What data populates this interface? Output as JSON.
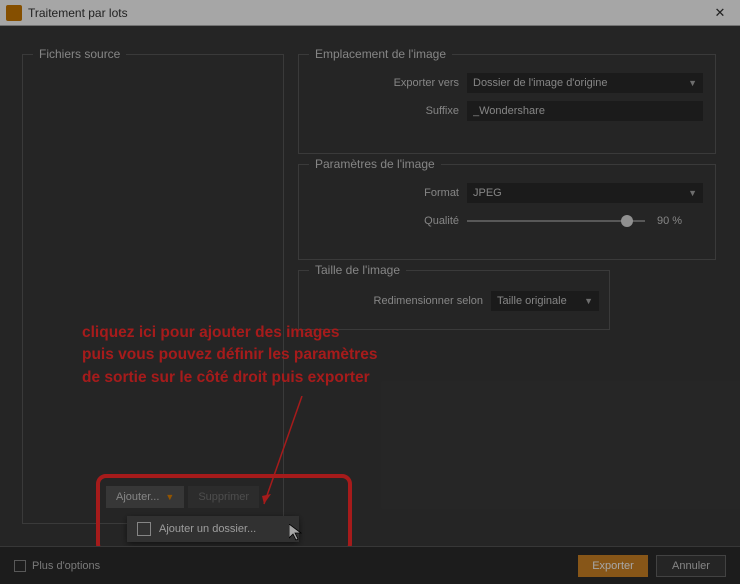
{
  "titlebar": {
    "title": "Traitement par lots"
  },
  "source": {
    "legend": "Fichiers source",
    "add_label": "Ajouter...",
    "del_label": "Supprimer",
    "menu_item": "Ajouter un dossier..."
  },
  "loc": {
    "legend": "Emplacement de l'image",
    "export_label": "Exporter vers",
    "export_value": "Dossier de l'image d'origine",
    "suffix_label": "Suffixe",
    "suffix_value": "_Wondershare"
  },
  "param": {
    "legend": "Paramètres de l'image",
    "format_label": "Format",
    "format_value": "JPEG",
    "quality_label": "Qualité",
    "quality_value": "90 %"
  },
  "size": {
    "legend": "Taille de l'image",
    "resize_label": "Redimensionner selon",
    "resize_value": "Taille originale"
  },
  "annotation": {
    "line1": "cliquez ici pour ajouter des images",
    "line2": "puis vous pouvez définir les paramètres",
    "line3": " de sortie sur le côté droit puis exporter"
  },
  "footer": {
    "more": "Plus d'options",
    "export": "Exporter",
    "cancel": "Annuler"
  }
}
